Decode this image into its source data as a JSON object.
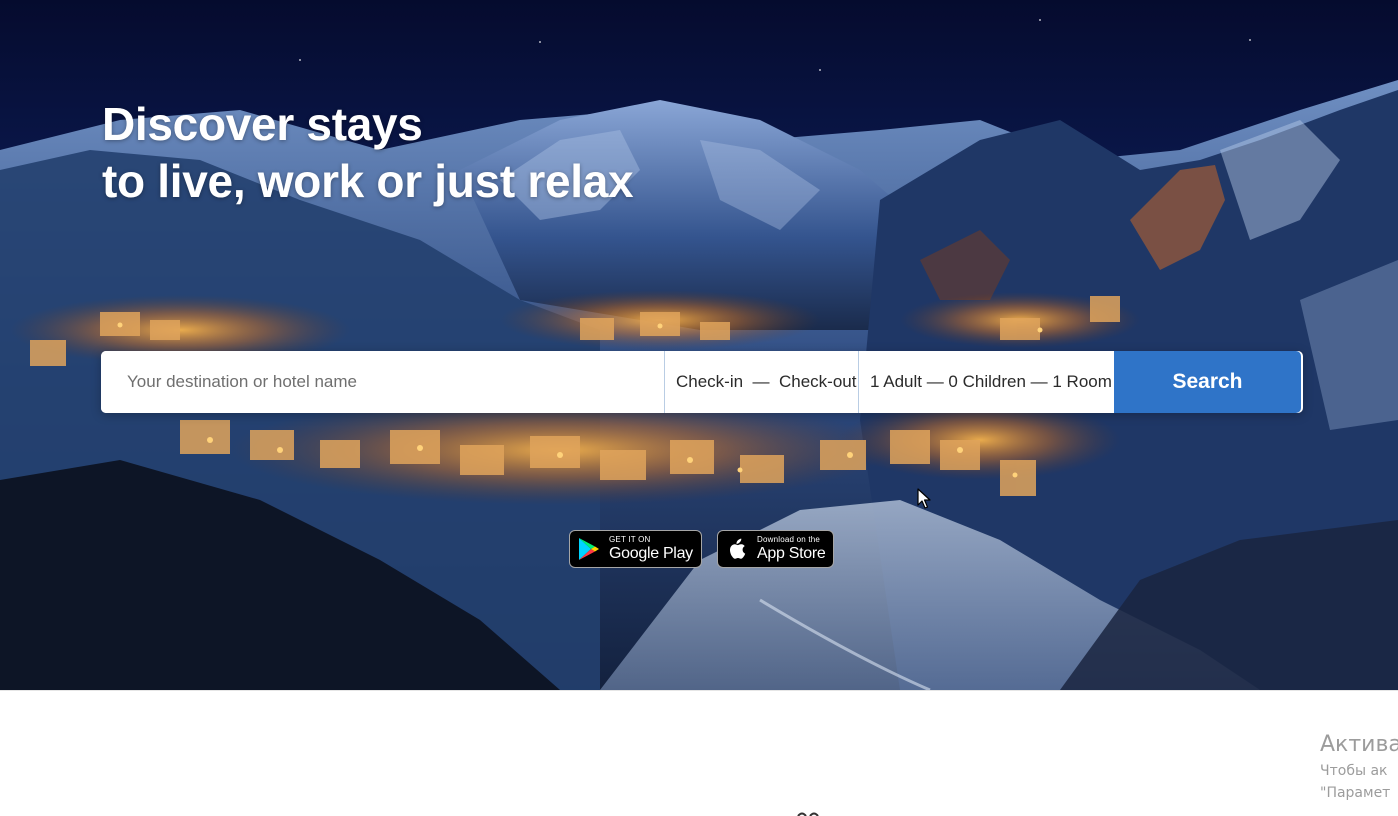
{
  "hero": {
    "title_line1": "Discover stays",
    "title_line2": "to live, work or just relax"
  },
  "search": {
    "destination_placeholder": "Your destination or hotel name",
    "destination_value": "",
    "dates_label": "Check-in  —  Check-out",
    "guests_label": "1 Adult — 0 Children — 1 Room",
    "button_label": "Search"
  },
  "apps": {
    "google_small": "GET IT ON",
    "google_big": "Google Play",
    "apple_small": "Download on the",
    "apple_big": "App Store"
  },
  "watermark": {
    "title": "Актива",
    "line1": "Чтобы ак",
    "line2": "\"Парамет"
  },
  "colors": {
    "accent": "#2f74c8",
    "hero_sky": "#07103a",
    "field_divider": "#b9cde4"
  },
  "icons": [
    "google-play-icon",
    "apple-icon",
    "mouse-cursor-icon"
  ]
}
